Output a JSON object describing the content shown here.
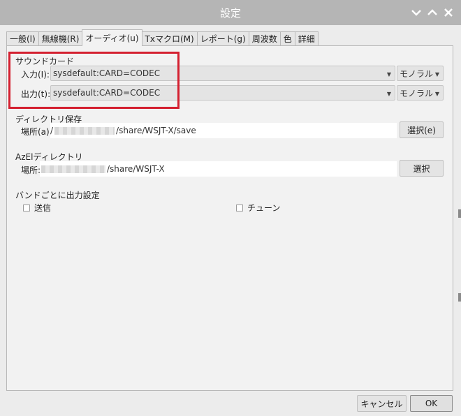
{
  "window": {
    "title": "設定"
  },
  "tabs": [
    {
      "label": "一般(l)"
    },
    {
      "label": "無線機(R)"
    },
    {
      "label": "オーディオ(u)",
      "active": true
    },
    {
      "label": "Txマクロ(M)"
    },
    {
      "label": "レポート(g)"
    },
    {
      "label": "周波数"
    },
    {
      "label": "色"
    },
    {
      "label": "詳細"
    }
  ],
  "soundcard": {
    "title": "サウンドカード",
    "input": {
      "label": "入力(I):",
      "device": "sysdefault:CARD=CODEC",
      "channel": "モノラル"
    },
    "output": {
      "label": "出力(t):",
      "device": "sysdefault:CARD=CODEC",
      "channel": "モノラル"
    }
  },
  "save_dir": {
    "title": "ディレクトリ保存",
    "label": "場所(a):",
    "prefix": "/",
    "suffix": "/share/WSJT-X/save",
    "button": "選択(e)"
  },
  "azel_dir": {
    "title": "AzElディレクトリ",
    "label": "場所:",
    "suffix": "/share/WSJT-X",
    "button": "選択"
  },
  "band_output": {
    "title": "バンドごとに出力設定",
    "send_label": "送信",
    "tune_label": "チューン"
  },
  "footer": {
    "cancel": "キャンセル",
    "ok": "OK"
  },
  "colors": {
    "titlebar": "#b5b5b5",
    "highlight": "#d42030",
    "ok_border": "#8a8a8a"
  }
}
